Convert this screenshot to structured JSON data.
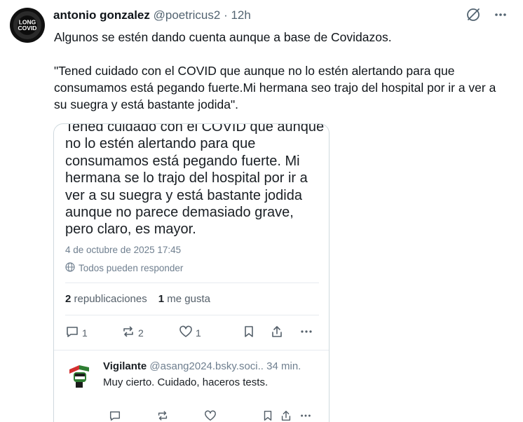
{
  "tweet": {
    "author_name": "antonio gonzalez",
    "handle": "@poetricus2",
    "separator": "·",
    "time": "12h",
    "avatar_lines": [
      "LONG",
      "COVID"
    ],
    "text": "Algunos se estén dando cuenta aunque a base de Covidazos.\n\n\"Tened cuidado con el COVID que aunque no lo estén alertando para que consumamos está pegando fuerte.Mi hermana seo trajo del hospital por ir a ver a su suegra y está bastante jodida\"."
  },
  "embed": {
    "post_text": "Tened cuidado con el COVID que aunque no lo estén alertando para que consumamos está pegando fuerte. Mi hermana se lo trajo del hospital por ir a ver a su suegra y está bastante jodida aunque no parece demasiado grave, pero claro, es mayor.",
    "date": "4 de octubre de 2025 17:45",
    "reply_setting": "Todos pueden responder",
    "reposts_count": "2",
    "reposts_label": "republicaciones",
    "likes_count": "1",
    "likes_label": "me gusta",
    "actions": {
      "reply_count": "1",
      "repost_count": "2",
      "like_count": "1"
    },
    "reply": {
      "name": "Vigilante",
      "handle": "@asang2024.bsky.soci..",
      "time": "34 min.",
      "text": "Muy cierto. Cuidado, haceros tests."
    }
  },
  "colors": {
    "text": "#0f1419",
    "secondary": "#536471",
    "border": "#cfd9de",
    "icon": "#55606a"
  },
  "icons": [
    "grok-icon",
    "more-icon",
    "globe-icon",
    "reply-icon",
    "repost-icon",
    "like-icon",
    "bookmark-icon",
    "share-icon"
  ]
}
